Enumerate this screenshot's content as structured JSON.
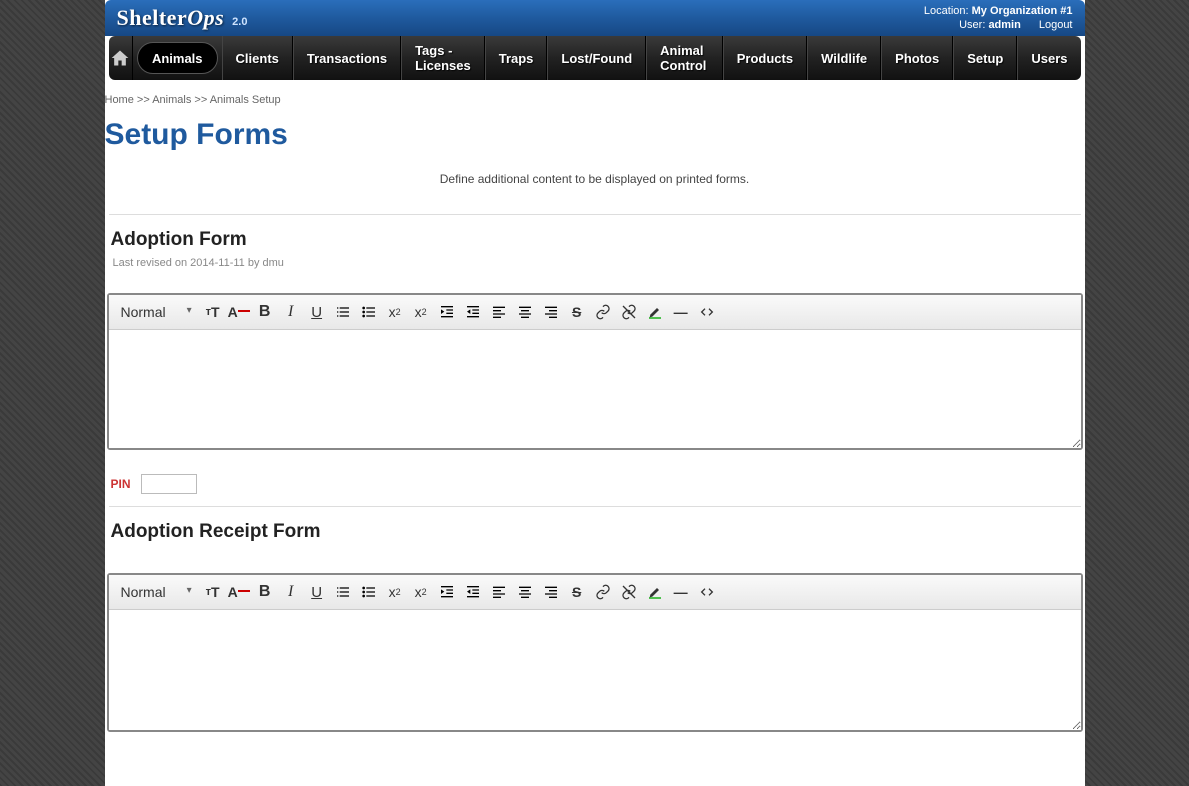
{
  "header": {
    "logo_main": "Shelter",
    "logo_ops": "Ops",
    "version": "2.0",
    "location_label": "Location:",
    "location_value": "My Organization #1",
    "user_label": "User:",
    "user_value": "admin",
    "logout": "Logout"
  },
  "nav": {
    "items": [
      {
        "label": "Animals",
        "active": true
      },
      {
        "label": "Clients"
      },
      {
        "label": "Transactions"
      },
      {
        "label": "Tags - Licenses"
      },
      {
        "label": "Traps"
      },
      {
        "label": "Lost/Found"
      },
      {
        "label": "Animal Control"
      },
      {
        "label": "Products"
      },
      {
        "label": "Wildlife"
      },
      {
        "label": "Photos"
      },
      {
        "label": "Setup"
      },
      {
        "label": "Users"
      }
    ]
  },
  "breadcrumb": {
    "home": "Home",
    "sep": ">>",
    "animals": "Animals",
    "setup": "Animals Setup"
  },
  "page": {
    "title": "Setup Forms",
    "description": "Define additional content to be displayed on printed forms."
  },
  "sections": [
    {
      "title": "Adoption Form",
      "revision": "Last revised on 2014-11-11 by dmu"
    },
    {
      "title": "Adoption Receipt Form",
      "revision": ""
    }
  ],
  "pin": {
    "label": "PIN",
    "value": ""
  },
  "toolbar": {
    "format": "Normal",
    "icons": [
      "font-size",
      "text-color",
      "bold",
      "italic",
      "underline",
      "ordered-list",
      "unordered-list",
      "subscript",
      "superscript",
      "indent",
      "outdent",
      "align-left",
      "align-center",
      "align-right",
      "strikethrough",
      "link",
      "unlink",
      "highlight",
      "hr",
      "code"
    ]
  }
}
